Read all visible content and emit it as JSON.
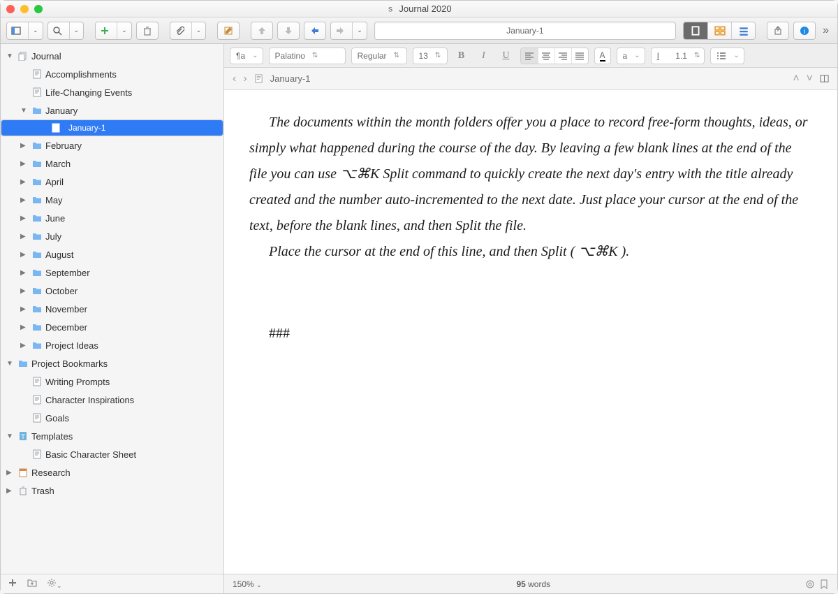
{
  "window": {
    "title": "Journal 2020"
  },
  "toolbar": {
    "address": "January-1",
    "view_mode": "Document"
  },
  "format_bar": {
    "paragraph": "¶a",
    "font": "Palatino",
    "weight": "Regular",
    "size": "13",
    "line_spacing": "1.1",
    "letter_box": "a"
  },
  "breadcrumb": {
    "doc": "January-1"
  },
  "document": {
    "p1": "The documents within the month folders offer you a place to record free-form thoughts, ideas, or simply what happened during the course of the day. By leaving a few blank lines at the end of the file you can use ⌥⌘K Split command to quickly create the next day's entry with the title already created and the number auto-incremented to the next date. Just place your cursor at the end of the text, before the blank lines, and then Split the file.",
    "p2": "Place the cursor at the end of this line, and then Split ( ⌥⌘K ).",
    "hashes": "###"
  },
  "status": {
    "zoom": "150%",
    "words": "95",
    "words_label": "words"
  },
  "sidebar": {
    "items": [
      {
        "label": "Journal",
        "icon": "doc-stack",
        "indent": 0,
        "disc": "▼"
      },
      {
        "label": "Accomplishments",
        "icon": "text",
        "indent": 1,
        "disc": ""
      },
      {
        "label": "Life-Changing Events",
        "icon": "text",
        "indent": 1,
        "disc": ""
      },
      {
        "label": "January",
        "icon": "folder",
        "indent": 1,
        "disc": "▼"
      },
      {
        "label": "January-1",
        "icon": "text",
        "indent": 2,
        "disc": "",
        "selected": true
      },
      {
        "label": "February",
        "icon": "folder",
        "indent": 1,
        "disc": "▶"
      },
      {
        "label": "March",
        "icon": "folder",
        "indent": 1,
        "disc": "▶"
      },
      {
        "label": "April",
        "icon": "folder",
        "indent": 1,
        "disc": "▶"
      },
      {
        "label": "May",
        "icon": "folder",
        "indent": 1,
        "disc": "▶"
      },
      {
        "label": "June",
        "icon": "folder",
        "indent": 1,
        "disc": "▶"
      },
      {
        "label": "July",
        "icon": "folder",
        "indent": 1,
        "disc": "▶"
      },
      {
        "label": "August",
        "icon": "folder",
        "indent": 1,
        "disc": "▶"
      },
      {
        "label": "September",
        "icon": "folder",
        "indent": 1,
        "disc": "▶"
      },
      {
        "label": "October",
        "icon": "folder",
        "indent": 1,
        "disc": "▶"
      },
      {
        "label": "November",
        "icon": "folder",
        "indent": 1,
        "disc": "▶"
      },
      {
        "label": "December",
        "icon": "folder",
        "indent": 1,
        "disc": "▶"
      },
      {
        "label": "Project Ideas",
        "icon": "folder",
        "indent": 1,
        "disc": "▶"
      },
      {
        "label": "Project Bookmarks",
        "icon": "folder",
        "indent": 0,
        "disc": "▼"
      },
      {
        "label": "Writing Prompts",
        "icon": "text",
        "indent": 1,
        "disc": ""
      },
      {
        "label": "Character Inspirations",
        "icon": "text",
        "indent": 1,
        "disc": ""
      },
      {
        "label": "Goals",
        "icon": "text",
        "indent": 1,
        "disc": ""
      },
      {
        "label": "Templates",
        "icon": "template",
        "indent": 0,
        "disc": "▼"
      },
      {
        "label": "Basic Character Sheet",
        "icon": "text-plus",
        "indent": 1,
        "disc": ""
      },
      {
        "label": "Research",
        "icon": "research",
        "indent": 0,
        "disc": "▶"
      },
      {
        "label": "Trash",
        "icon": "trash",
        "indent": 0,
        "disc": "▶"
      }
    ]
  }
}
